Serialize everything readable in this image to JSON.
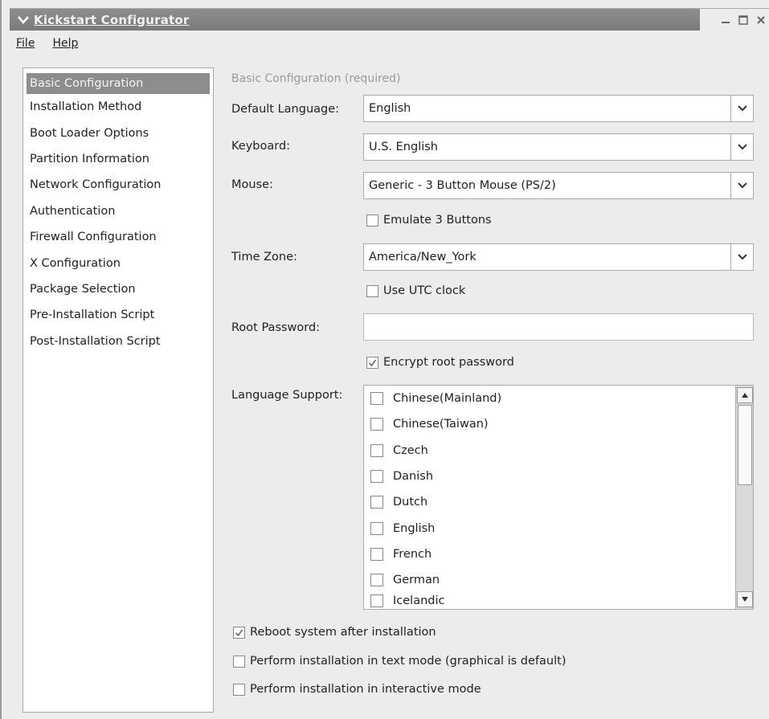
{
  "window": {
    "title": "Kickstart Configurator",
    "minimize_icon": "minimize-icon",
    "maximize_icon": "maximize-icon",
    "close_icon": "close-icon"
  },
  "menu": {
    "file": "File",
    "help": "Help"
  },
  "sidebar": {
    "items": [
      {
        "label": "Basic Configuration",
        "active": true
      },
      {
        "label": "Installation Method"
      },
      {
        "label": "Boot Loader Options"
      },
      {
        "label": "Partition Information"
      },
      {
        "label": "Network Configuration"
      },
      {
        "label": "Authentication"
      },
      {
        "label": "Firewall Configuration"
      },
      {
        "label": "X Configuration"
      },
      {
        "label": "Package Selection"
      },
      {
        "label": "Pre-Installation Script"
      },
      {
        "label": "Post-Installation Script"
      }
    ]
  },
  "main": {
    "section_title": "Basic Configuration (required)",
    "default_language": {
      "label": "Default Language:",
      "value": "English"
    },
    "keyboard": {
      "label": "Keyboard:",
      "value": "U.S. English"
    },
    "mouse": {
      "label": "Mouse:",
      "value": "Generic - 3 Button Mouse (PS/2)"
    },
    "emulate": {
      "label": "Emulate 3 Buttons",
      "checked": false
    },
    "time_zone": {
      "label": "Time Zone:",
      "value": "America/New_York"
    },
    "utc": {
      "label": "Use UTC clock",
      "checked": false
    },
    "root_password": {
      "label": "Root Password:",
      "value": ""
    },
    "encrypt": {
      "label": "Encrypt root password",
      "checked": true
    },
    "language_support": {
      "label": "Language Support:",
      "items": [
        {
          "label": "Chinese(Mainland)",
          "checked": false
        },
        {
          "label": "Chinese(Taiwan)",
          "checked": false
        },
        {
          "label": "Czech",
          "checked": false
        },
        {
          "label": "Danish",
          "checked": false
        },
        {
          "label": "Dutch",
          "checked": false
        },
        {
          "label": "English",
          "checked": false
        },
        {
          "label": "French",
          "checked": false
        },
        {
          "label": "German",
          "checked": false
        },
        {
          "label": "Icelandic",
          "checked": false
        }
      ]
    },
    "reboot": {
      "label": "Reboot system after installation",
      "checked": true
    },
    "text_mode": {
      "label": "Perform installation in text mode (graphical is default)",
      "checked": false
    },
    "interactive": {
      "label": "Perform installation in interactive mode",
      "checked": false
    }
  },
  "icons": {
    "window_menu": "chevron-down-icon",
    "combo_arrow": "chevron-down-icon",
    "scroll_up": "arrow-up-icon",
    "scroll_down": "arrow-down-icon",
    "check": "check-icon"
  }
}
